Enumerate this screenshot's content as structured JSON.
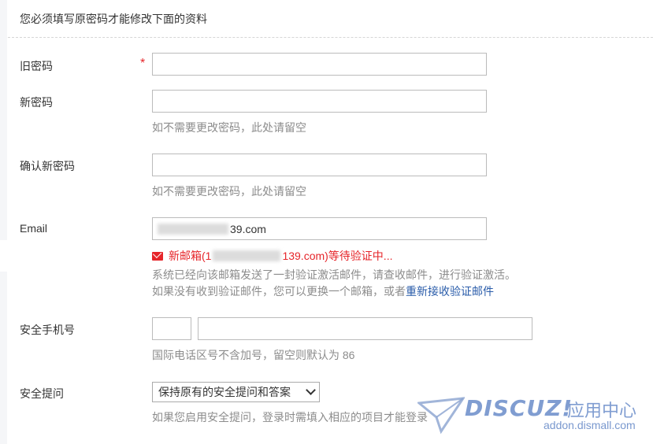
{
  "notice": "您必须填写原密码才能修改下面的资料",
  "form": {
    "old_password": {
      "label": "旧密码",
      "required_mark": "*",
      "value": ""
    },
    "new_password": {
      "label": "新密码",
      "value": "",
      "hint": "如不需要更改密码，此处请留空"
    },
    "confirm_password": {
      "label": "确认新密码",
      "value": "",
      "hint": "如不需要更改密码，此处请留空"
    },
    "email": {
      "label": "Email",
      "value_suffix": "39.com",
      "status_prefix": "新邮箱(1",
      "status_suffix": "139.com)等待验证中...",
      "info_line1": "系统已经向该邮箱发送了一封验证激活邮件，请查收邮件，进行验证激活。",
      "info_line2_prefix": "如果没有收到验证邮件，您可以更换一个邮箱，或者",
      "resend_link": "重新接收验证邮件"
    },
    "mobile": {
      "label": "安全手机号",
      "area_code": "",
      "number": "",
      "hint": "国际电话区号不含加号，留空则默认为 86"
    },
    "security_question": {
      "label": "安全提问",
      "selected": "保持原有的安全提问和答案",
      "hint": "如果您启用安全提问，登录时需填入相应的项目才能登录"
    }
  },
  "watermark": {
    "brand": "DISCUZ!",
    "cn": "应用中心",
    "url": "addon.dismall.com"
  }
}
